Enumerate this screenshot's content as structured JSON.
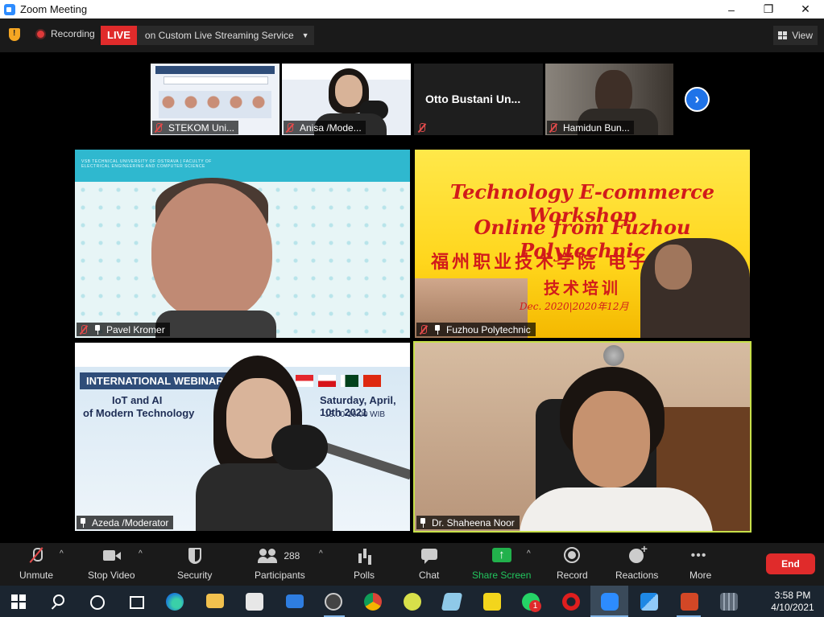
{
  "window": {
    "title": "Zoom Meeting",
    "minimize": "–",
    "maximize": "❐",
    "close": "✕"
  },
  "status": {
    "recording_label": "Recording",
    "live_badge": "LIVE",
    "live_service": "on Custom Live Streaming Service",
    "view_label": "View"
  },
  "thumbnails": [
    {
      "name": "STEKOM Uni...",
      "muted": true
    },
    {
      "name": "Anisa /Mode...",
      "muted": true
    },
    {
      "name": "Otto Bustani Un...",
      "muted": true,
      "video_off": true
    },
    {
      "name": "Hamidun Bun...",
      "muted": true
    }
  ],
  "tiles": {
    "t1": {
      "name": "Pavel Kromer",
      "banner": "VSB TECHNICAL UNIVERSITY OF OSTRAVA | FACULTY OF ELECTRICAL ENGINEERING AND COMPUTER SCIENCE"
    },
    "t2": {
      "name": "Fuzhou Polytechnic",
      "line1": "Technology E-commerce Workshop",
      "line2": "Online from Fuzhou Polytechnic",
      "line3": "福州职业技术学院 电子商务专业",
      "line4": "技术培训",
      "line5": "Dec. 2020|2020年12月"
    },
    "t3": {
      "name": "Azeda /Moderator",
      "webinar": "INTERNATIONAL WEBINAR",
      "topic1": "IoT and AI",
      "topic2": "of Modern Technology",
      "date": "Saturday, April, 10th 2021",
      "time": "13.00-16.00 WIB"
    },
    "t4": {
      "name": "Dr. Shaheena Noor",
      "active_speaker": true
    }
  },
  "toolbar": {
    "unmute": "Unmute",
    "stop_video": "Stop Video",
    "security": "Security",
    "participants": "Participants",
    "participant_count": "288",
    "polls": "Polls",
    "chat": "Chat",
    "share_screen": "Share Screen",
    "record": "Record",
    "reactions": "Reactions",
    "more": "More",
    "end": "End"
  },
  "taskbar": {
    "time": "3:58 PM",
    "date": "4/10/2021",
    "whatsapp_badge": "1"
  },
  "colors": {
    "live": "#e02b2b",
    "share": "#22b14c",
    "speaker_border": "#c7e04a",
    "next": "#1f73e8"
  }
}
